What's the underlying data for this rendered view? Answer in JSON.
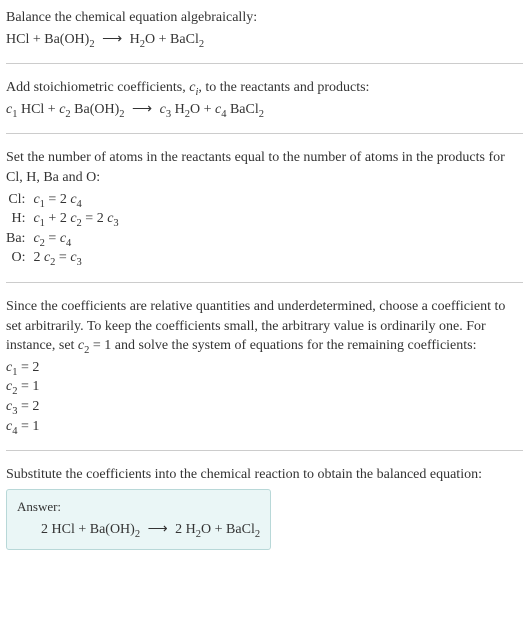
{
  "section1": {
    "intro": "Balance the chemical equation algebraically:",
    "equation": "HCl + Ba(OH)₂ ⟶ H₂O + BaCl₂"
  },
  "section2": {
    "intro": "Add stoichiometric coefficients, cᵢ, to the reactants and products:",
    "equation": "c₁ HCl + c₂ Ba(OH)₂ ⟶ c₃ H₂O + c₄ BaCl₂"
  },
  "section3": {
    "intro": "Set the number of atoms in the reactants equal to the number of atoms in the products for Cl, H, Ba and O:",
    "rows": [
      {
        "label": "Cl:",
        "eq": "c₁ = 2 c₄"
      },
      {
        "label": "H:",
        "eq": "c₁ + 2 c₂ = 2 c₃"
      },
      {
        "label": "Ba:",
        "eq": "c₂ = c₄"
      },
      {
        "label": "O:",
        "eq": "2 c₂ = c₃"
      }
    ]
  },
  "section4": {
    "intro": "Since the coefficients are relative quantities and underdetermined, choose a coefficient to set arbitrarily. To keep the coefficients small, the arbitrary value is ordinarily one. For instance, set c₂ = 1 and solve the system of equations for the remaining coefficients:",
    "coeffs": [
      "c₁ = 2",
      "c₂ = 1",
      "c₃ = 2",
      "c₄ = 1"
    ]
  },
  "section5": {
    "intro": "Substitute the coefficients into the chemical reaction to obtain the balanced equation:",
    "answer_label": "Answer:",
    "answer_eq": "2 HCl + Ba(OH)₂ ⟶ 2 H₂O + BaCl₂"
  }
}
